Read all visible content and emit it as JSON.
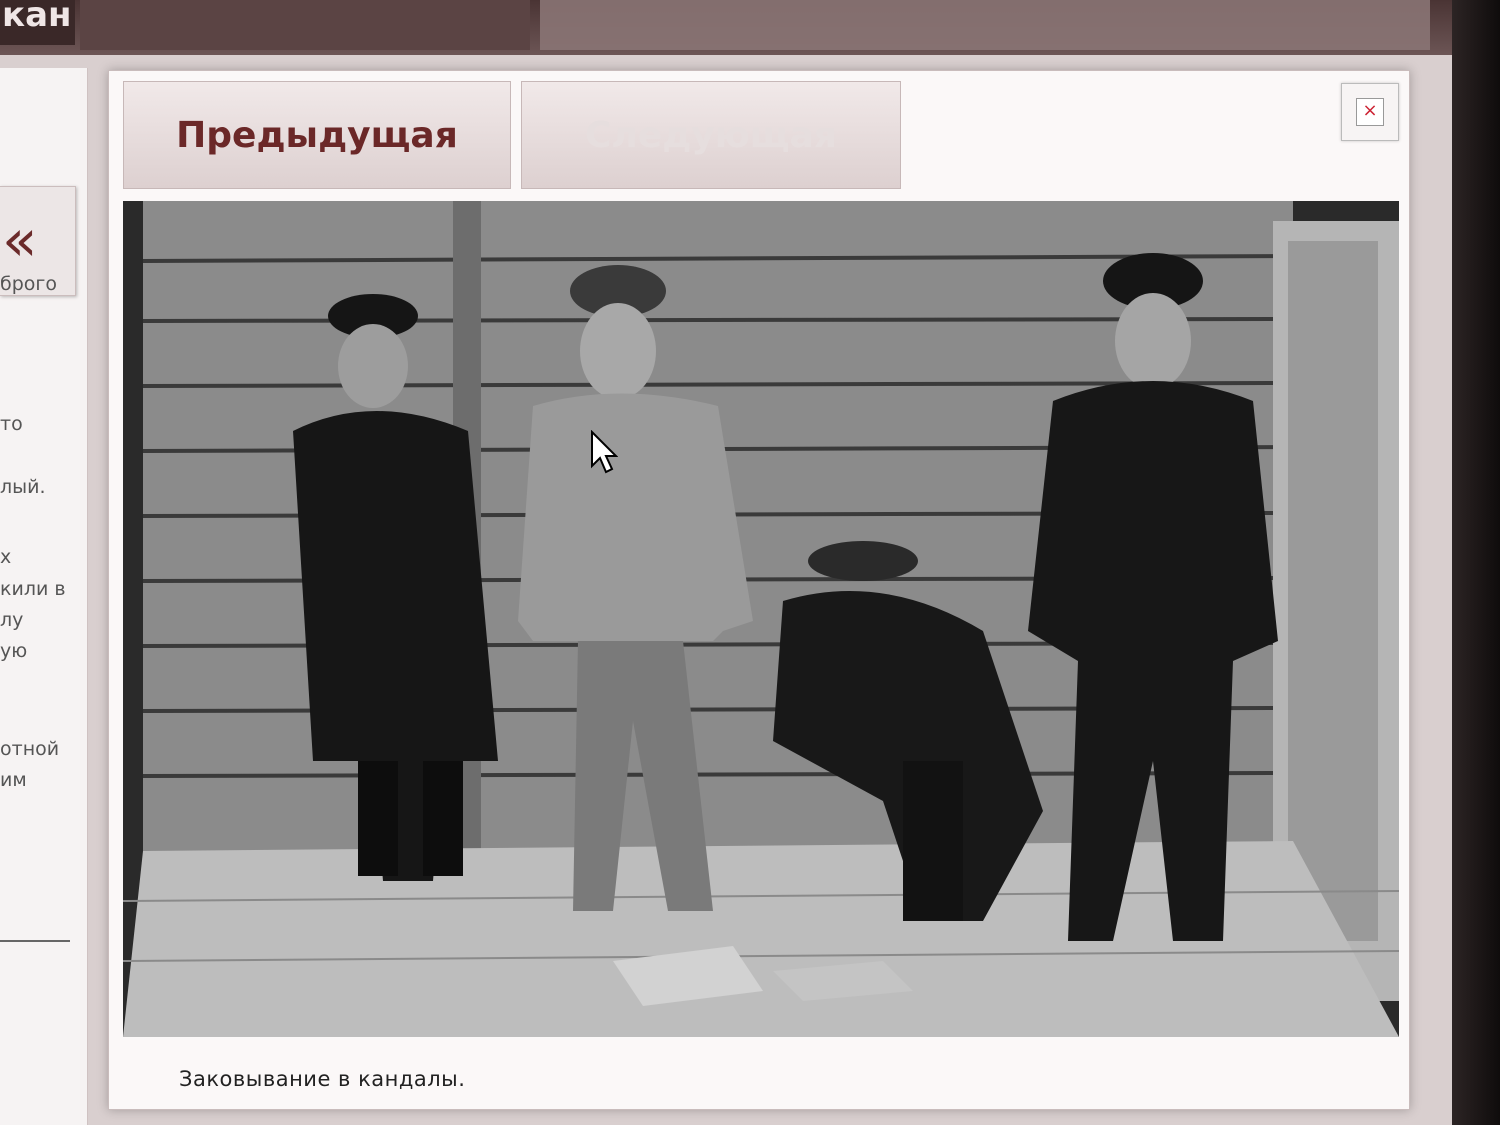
{
  "header": {
    "tab_left_label": "кан",
    "tab_mid_label": "",
    "tab_right_label": ""
  },
  "sidebar": {
    "back_label": "«",
    "text_lines": [
      "брого",
      "то",
      "лый.",
      "х",
      "кили в",
      "лу",
      "ую",
      "отной",
      "им"
    ]
  },
  "lightbox": {
    "prev_label": "Предыдущая",
    "next_label": "Следующая",
    "close_label": "×",
    "caption": "Заковывание в кандалы."
  },
  "colors": {
    "accent": "#6b2828",
    "header_dark": "#3a2828",
    "panel_bg": "#fbf8f8"
  },
  "icons": {
    "back": "double-chevron-left-icon",
    "close": "close-icon",
    "cursor": "mouse-pointer-icon"
  }
}
